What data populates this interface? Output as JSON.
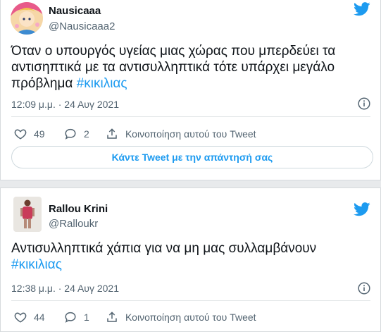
{
  "tweets": [
    {
      "name": "Nausicaaa",
      "handle": "@Nausicaaa2",
      "text": "Όταν ο υπουργός υγείας μιας χώρας που μπερδεύει τα αντισηπτικά με τα αντισυλληπτικά τότε υπάρχει μεγάλο πρόβλημα ",
      "hashtag": "#κικιλιας",
      "time": "12:09 μ.μ. · 24 Αυγ 2021",
      "likes": "49",
      "replies": "2",
      "share_label": "Κοινοποίηση αυτού του Tweet",
      "reply_button": "Κάντε Tweet με την απάντησή σας"
    },
    {
      "name": "Rallou Krini",
      "handle": "@Ralloukr",
      "text": "Αντισυλληπτικά χάπια για να μη μας συλλαμβάνουν",
      "hashtag": "#κικιλιας",
      "time": "12:38 μ.μ. · 24 Αυγ 2021",
      "likes": "44",
      "replies": "1",
      "share_label": "Κοινοποίηση αυτού του Tweet"
    }
  ],
  "colors": {
    "accent": "#1d9bf0",
    "muted": "#536471",
    "text": "#0f1419"
  },
  "icons": [
    "twitter-bird-icon",
    "info-icon",
    "heart-icon",
    "reply-bubble-icon",
    "share-icon"
  ]
}
